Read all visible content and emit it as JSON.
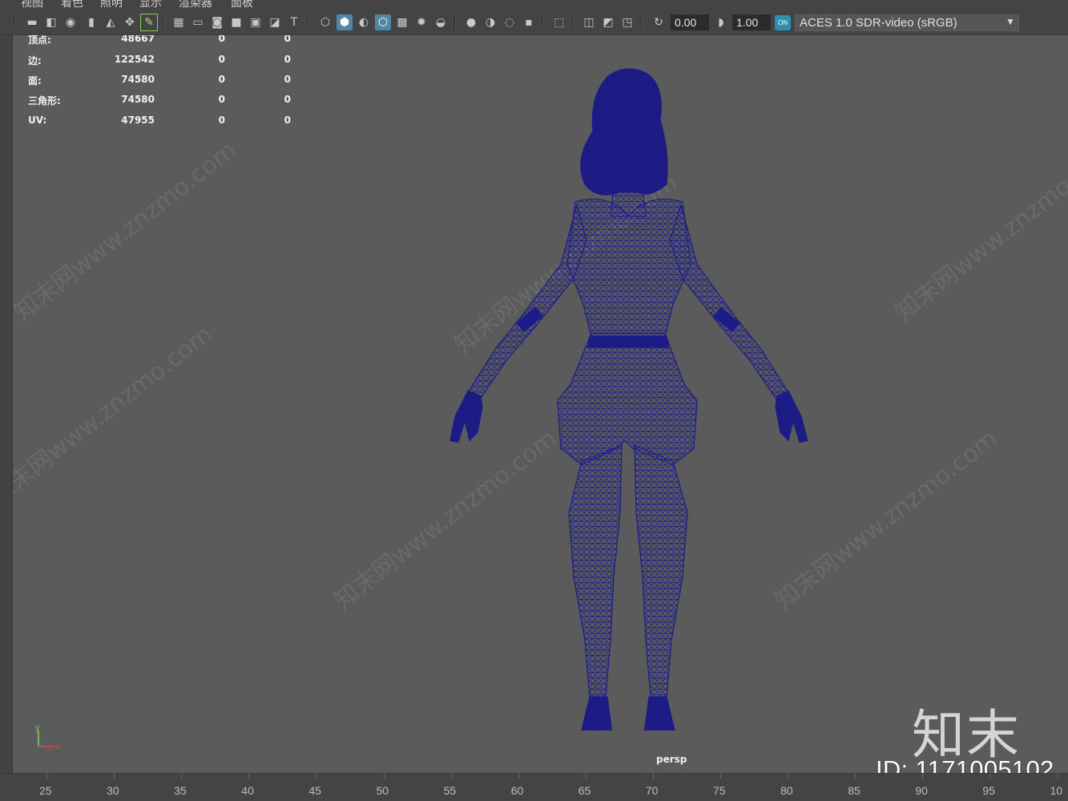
{
  "menu": {
    "items": [
      "视图",
      "着色",
      "照明",
      "显示",
      "渲染器",
      "面板"
    ]
  },
  "toolbar": {
    "exposure_value": "0.00",
    "gamma_value": "1.00",
    "color_mgmt_label": "ON",
    "color_space": "ACES 1.0 SDR-video (sRGB)"
  },
  "hud": {
    "rows": [
      {
        "label": "顶点:",
        "v1": "48667",
        "v2": "0",
        "v3": "0"
      },
      {
        "label": "边:",
        "v1": "122542",
        "v2": "0",
        "v3": "0"
      },
      {
        "label": "面:",
        "v1": "74580",
        "v2": "0",
        "v3": "0"
      },
      {
        "label": "三角形:",
        "v1": "74580",
        "v2": "0",
        "v3": "0"
      },
      {
        "label": "UV:",
        "v1": "47955",
        "v2": "0",
        "v3": "0"
      }
    ]
  },
  "viewport": {
    "camera": "persp",
    "wireframe_color": "#1f1f8f",
    "background_color": "#5b5b5b"
  },
  "watermark": {
    "text": "知末网www.znzmo.com",
    "logo": "知末",
    "id_text": "ID: 1171005102"
  },
  "axis": {
    "y_label": "y",
    "x_label": "x"
  },
  "timeline": {
    "ticks": [
      "25",
      "30",
      "35",
      "40",
      "45",
      "50",
      "55",
      "60",
      "65",
      "70",
      "75",
      "80",
      "85",
      "90",
      "95",
      "10"
    ]
  }
}
